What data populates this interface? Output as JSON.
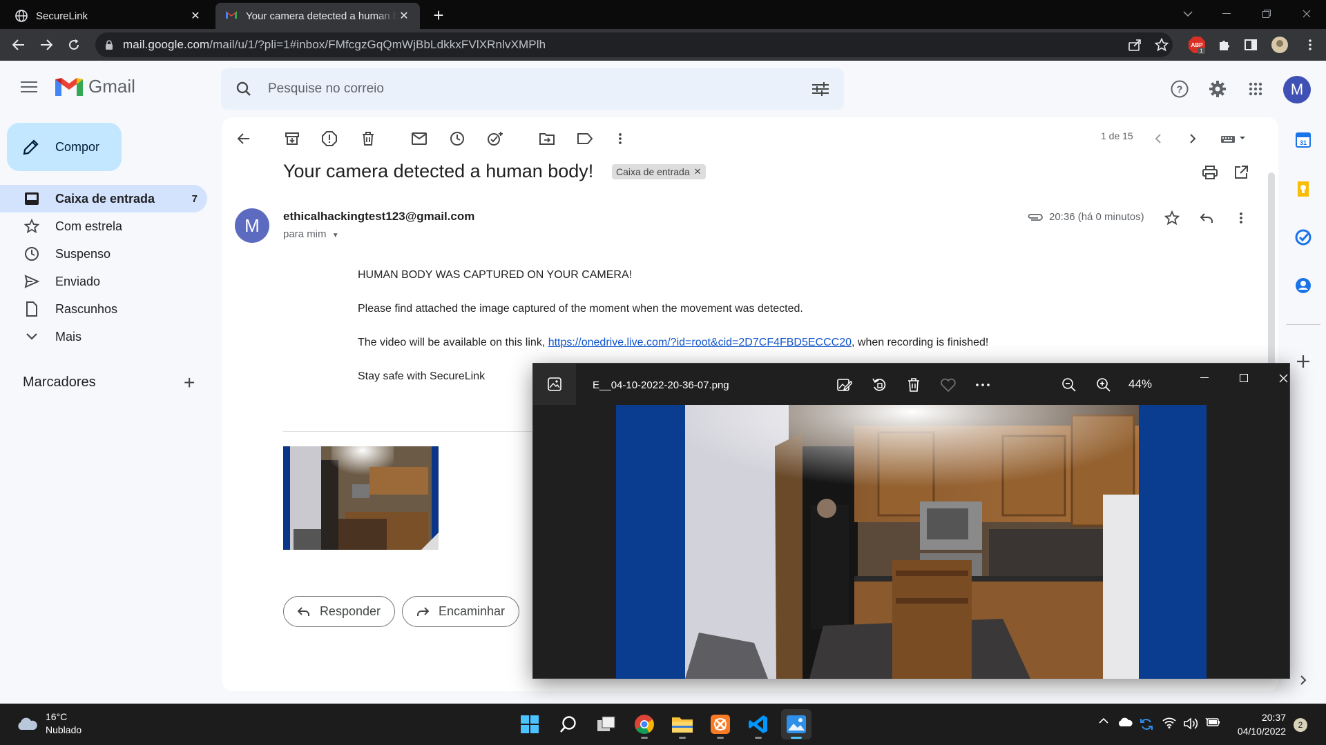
{
  "browser": {
    "tabs": [
      {
        "title": "SecureLink",
        "icon": "globe-icon",
        "active": false
      },
      {
        "title": "Your camera detected a human body!",
        "icon": "gmail-icon",
        "active": true
      }
    ],
    "url_domain": "mail.google.com",
    "url_path": "/mail/u/1/?pli=1#inbox/FMfcgzGqQmWjBbLdkkxFVlXRnlvXMPlh",
    "extension_badge": "1",
    "extension_label": "ABP"
  },
  "gmail": {
    "app_name": "Gmail",
    "search_placeholder": "Pesquise no correio",
    "account_initial": "M",
    "compose_label": "Compor",
    "nav": [
      {
        "label": "Caixa de entrada",
        "icon": "inbox-icon",
        "count": "7",
        "active": true
      },
      {
        "label": "Com estrela",
        "icon": "star-icon",
        "count": "",
        "active": false
      },
      {
        "label": "Suspenso",
        "icon": "clock-icon",
        "count": "",
        "active": false
      },
      {
        "label": "Enviado",
        "icon": "send-icon",
        "count": "",
        "active": false
      },
      {
        "label": "Rascunhos",
        "icon": "draft-icon",
        "count": "",
        "active": false
      },
      {
        "label": "Mais",
        "icon": "chevron-down-icon",
        "count": "",
        "active": false
      }
    ],
    "labels_header": "Marcadores",
    "pager": "1 de 15"
  },
  "email": {
    "subject": "Your camera detected a human body!",
    "label_chip": "Caixa de entrada",
    "sender_initial": "M",
    "sender": "ethicalhackingtest123@gmail.com",
    "to": "para mim",
    "time": "20:36 (há 0 minutos)",
    "body": {
      "line1": "HUMAN BODY WAS CAPTURED ON YOUR CAMERA!",
      "line2": "Please find attached the image captured of the moment when the movement was detected.",
      "line3_prefix": "The video will be available on this link, ",
      "line3_link": "https://onedrive.live.com/?id=root&cid=2D7CF4FBD5ECCC20",
      "line3_suffix": ", when recording is finished!",
      "line4": "Stay safe with SecureLink"
    },
    "reply_label": "Responder",
    "forward_label": "Encaminhar"
  },
  "viewer": {
    "filename": "E__04-10-2022-20-36-07.png",
    "zoom": "44%"
  },
  "taskbar": {
    "temperature": "16°C",
    "weather": "Nublado",
    "time": "20:37",
    "date": "04/10/2022",
    "notifications": "2",
    "apps": [
      "windows-start",
      "search",
      "task-view",
      "chrome",
      "file-explorer",
      "xampp",
      "vscode",
      "photos"
    ]
  },
  "colors": {
    "gmail_bg": "#f6f8fc",
    "active_nav": "#d3e3fd",
    "compose": "#c2e7ff",
    "link": "#1155cc",
    "viewer_bg": "#1f1f1f",
    "image_border_blue": "#0a3d8f"
  }
}
